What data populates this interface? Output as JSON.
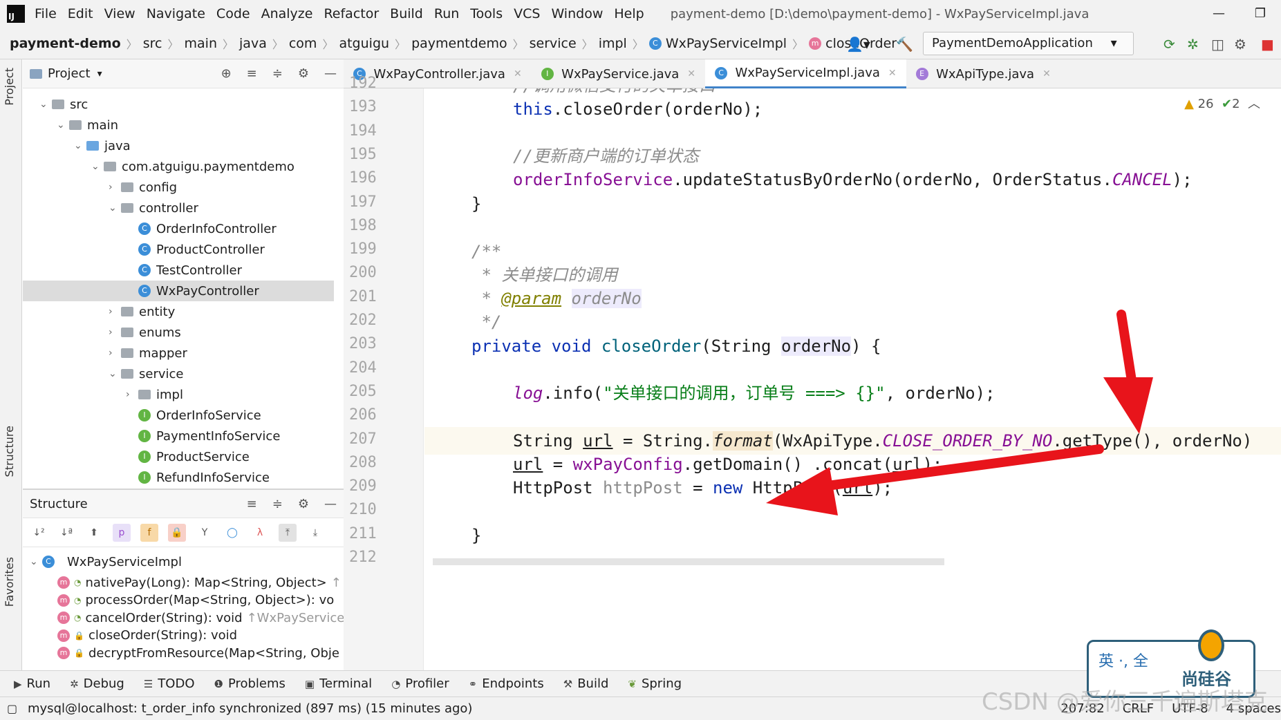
{
  "menu": {
    "items": [
      "File",
      "Edit",
      "View",
      "Navigate",
      "Code",
      "Analyze",
      "Refactor",
      "Build",
      "Run",
      "Tools",
      "VCS",
      "Window",
      "Help"
    ],
    "title": "payment-demo [D:\\demo\\payment-demo] - WxPayServiceImpl.java"
  },
  "breadcrumb": {
    "project": "payment-demo",
    "parts": [
      "src",
      "main",
      "java",
      "com",
      "atguigu",
      "paymentdemo",
      "service",
      "impl",
      "WxPayServiceImpl",
      "closeOrder"
    ]
  },
  "run_config": "PaymentDemoApplication",
  "project_panel": {
    "title": "Project",
    "tree": [
      {
        "label": "src",
        "depth": 0,
        "open": true,
        "kind": "folder"
      },
      {
        "label": "main",
        "depth": 1,
        "open": true,
        "kind": "folder"
      },
      {
        "label": "java",
        "depth": 2,
        "open": true,
        "kind": "folder-blue"
      },
      {
        "label": "com.atguigu.paymentdemo",
        "depth": 3,
        "open": true,
        "kind": "folder"
      },
      {
        "label": "config",
        "depth": 4,
        "open": false,
        "kind": "folder"
      },
      {
        "label": "controller",
        "depth": 4,
        "open": true,
        "kind": "folder"
      },
      {
        "label": "OrderInfoController",
        "depth": 5,
        "kind": "class"
      },
      {
        "label": "ProductController",
        "depth": 5,
        "kind": "class"
      },
      {
        "label": "TestController",
        "depth": 5,
        "kind": "class"
      },
      {
        "label": "WxPayController",
        "depth": 5,
        "kind": "class",
        "selected": true
      },
      {
        "label": "entity",
        "depth": 4,
        "open": false,
        "kind": "folder"
      },
      {
        "label": "enums",
        "depth": 4,
        "open": false,
        "kind": "folder"
      },
      {
        "label": "mapper",
        "depth": 4,
        "open": false,
        "kind": "folder"
      },
      {
        "label": "service",
        "depth": 4,
        "open": true,
        "kind": "folder"
      },
      {
        "label": "impl",
        "depth": 5,
        "open": false,
        "kind": "folder"
      },
      {
        "label": "OrderInfoService",
        "depth": 5,
        "kind": "interface"
      },
      {
        "label": "PaymentInfoService",
        "depth": 5,
        "kind": "interface"
      },
      {
        "label": "ProductService",
        "depth": 5,
        "kind": "interface"
      },
      {
        "label": "RefundInfoService",
        "depth": 5,
        "kind": "interface"
      }
    ]
  },
  "structure_panel": {
    "title": "Structure",
    "root": "WxPayServiceImpl",
    "members": [
      {
        "sig": "nativePay(Long): Map<String, Object>",
        "extra": "↑"
      },
      {
        "sig": "processOrder(Map<String, Object>): vo",
        "extra": ""
      },
      {
        "sig": "cancelOrder(String): void",
        "extra": "↑WxPayService"
      },
      {
        "sig": "closeOrder(String): void",
        "extra": "",
        "private": true
      },
      {
        "sig": "decryptFromResource(Map<String, Obje",
        "extra": "",
        "private": true
      }
    ]
  },
  "side_tabs": {
    "project": "Project",
    "structure": "Structure",
    "favorites": "Favorites"
  },
  "editor_tabs": [
    {
      "label": "WxPayController.java",
      "icon": "C",
      "active": false
    },
    {
      "label": "WxPayService.java",
      "icon": "I",
      "active": false
    },
    {
      "label": "WxPayServiceImpl.java",
      "icon": "C",
      "active": true
    },
    {
      "label": "WxApiType.java",
      "icon": "E",
      "active": false
    }
  ],
  "inspections": {
    "warnings": "26",
    "weak": "2"
  },
  "line_numbers": [
    "192",
    "193",
    "194",
    "195",
    "196",
    "197",
    "198",
    "199",
    "200",
    "201",
    "202",
    "203",
    "204",
    "205",
    "206",
    "207",
    "208",
    "209",
    "210",
    "211",
    "212"
  ],
  "code": {
    "l192": "//调用微信支付的关单接口",
    "l193a": "this",
    "l193b": ".closeOrder(orderNo);",
    "l195": "//更新商户端的订单状态",
    "l196a": "orderInfoService",
    "l196b": ".updateStatusByOrderNo(orderNo, OrderStatus.",
    "l196c": "CANCEL",
    "l196d": ");",
    "l197": "}",
    "l199": "/**",
    "l200": " * 关单接口的调用",
    "l201a": " * ",
    "l201b": "@param",
    "l201c": "orderNo",
    "l202": " */",
    "l203a": "private void ",
    "l203b": "closeOrder",
    "l203c": "(String ",
    "l203d": "orderNo",
    "l203e": ") {",
    "l205a": "log",
    "l205b": ".info(",
    "l205c": "\"关单接口的调用，订单号 ===> {}\"",
    "l205d": ", orderNo);",
    "l207a": "String ",
    "l207b": "url",
    "l207c": " = String.",
    "l207d": "format",
    "l207e": "(WxApiType.",
    "l207f": "CLOSE_ORDER_BY_NO",
    "l207g": ".getType(), orderNo)",
    "l208a": "url",
    "l208b": " = ",
    "l208c": "wxPayConfig",
    "l208d": ".getDomain() .concat(",
    "l208e": "url",
    "l208f": ");",
    "l209a": "HttpPost ",
    "l209b": "httpPost",
    "l209c": " = ",
    "l209d": "new",
    "l209e": " HttpPost(",
    "l209f": "url",
    "l209g": ");",
    "l211": "}"
  },
  "tool_windows": [
    "Run",
    "Debug",
    "TODO",
    "Problems",
    "Terminal",
    "Profiler",
    "Endpoints",
    "Build",
    "Spring"
  ],
  "status": {
    "message": "mysql@localhost: t_order_info synchronized (897 ms) (15 minutes ago)",
    "position": "207:82",
    "line_sep": "CRLF",
    "encoding": "UTF-8",
    "indent": "4 spaces"
  },
  "overlay_text": {
    "ime": "英 ·, 全",
    "brand": "尚硅谷"
  },
  "watermark": "CSDN @爱你三千遍斯塔克",
  "colors": {
    "annotation_arrow": "#e8141b",
    "accent": "#4083c9"
  }
}
